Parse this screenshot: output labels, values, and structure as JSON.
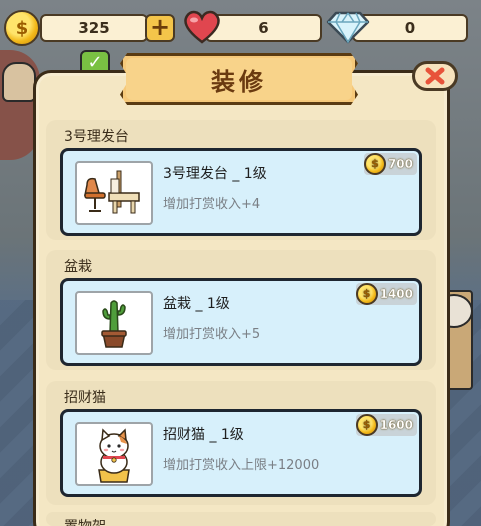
{
  "topbar": {
    "coins": "325",
    "hearts": "6",
    "gems": "0",
    "coin_symbol": "$",
    "plus_symbol": "+"
  },
  "modal": {
    "title": "装修",
    "close_symbol": "✕"
  },
  "items": [
    {
      "section": "3号理发台",
      "name": "3号理发台 _ 1级",
      "desc": "增加打赏收入+4",
      "price": "700",
      "icon": "barber-chair-icon"
    },
    {
      "section": "盆栽",
      "name": "盆栽 _ 1级",
      "desc": "增加打赏收入+5",
      "price": "1400",
      "icon": "cactus-pot-icon"
    },
    {
      "section": "招财猫",
      "name": "招财猫 _ 1级",
      "desc": "增加打赏收入上限+12000",
      "price": "1600",
      "icon": "lucky-cat-icon"
    },
    {
      "section": "置物架"
    }
  ],
  "colors": {
    "panel": "#f4e7c4",
    "card": "#ede0bd",
    "item_body": "#d7f0fb",
    "title_banner": "#f6c97a",
    "title_text": "#6a3a10",
    "close_x": "#e8533a",
    "coin": "#f2b91a",
    "heart": "#e0464f",
    "gem": "#bfe9f5"
  }
}
